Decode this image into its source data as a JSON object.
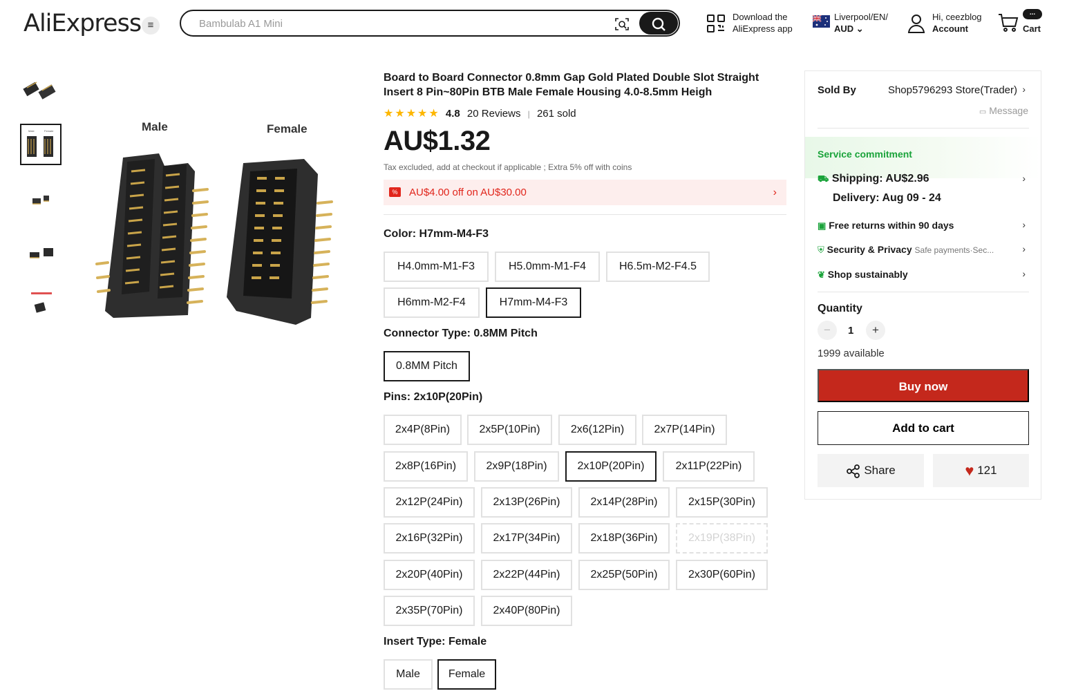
{
  "header": {
    "logo": "AliExpress",
    "search_placeholder": "Bambulab A1 Mini",
    "app_line1": "Download the",
    "app_line2": "AliExpress app",
    "locale_line1": "Liverpool/EN/",
    "locale_line2": "AUD",
    "account_line1": "Hi, ceezblog",
    "account_line2": "Account",
    "cart_label": "Cart",
    "cart_badge": "..."
  },
  "gallery": {
    "label_male": "Male",
    "label_female": "Female"
  },
  "product": {
    "title": "Board to Board Connector 0.8mm Gap Gold Plated Double Slot Straight Insert 8 Pin~80Pin BTB Male Female Housing 4.0-8.5mm Heigh",
    "rating": "4.8",
    "rating_stars": 5,
    "reviews": "20 Reviews",
    "sold": "261 sold",
    "price": "AU$1.32",
    "tax_note": "Tax excluded, add at checkout if applicable ; Extra 5% off with coins",
    "coupon": "AU$4.00 off on AU$30.00",
    "color_label": "Color: H7mm-M4-F3",
    "colors": [
      "H4.0mm-M1-F3",
      "H5.0mm-M1-F4",
      "H6.5m-M2-F4.5",
      "H6mm-M2-F4",
      "H7mm-M4-F3"
    ],
    "connector_label": "Connector Type: 0.8MM Pitch",
    "connectors": [
      "0.8MM Pitch"
    ],
    "pins_label": "Pins: 2x10P(20Pin)",
    "pins": [
      "2x4P(8Pin)",
      "2x5P(10Pin)",
      "2x6(12Pin)",
      "2x7P(14Pin)",
      "2x8P(16Pin)",
      "2x9P(18Pin)",
      "2x10P(20Pin)",
      "2x11P(22Pin)",
      "2x12P(24Pin)",
      "2x13P(26Pin)",
      "2x14P(28Pin)",
      "2x15P(30Pin)",
      "2x16P(32Pin)",
      "2x17P(34Pin)",
      "2x18P(36Pin)",
      "2x19P(38Pin)",
      "2x20P(40Pin)",
      "2x22P(44Pin)",
      "2x25P(50Pin)",
      "2x30P(60Pin)",
      "2x35P(70Pin)",
      "2x40P(80Pin)"
    ],
    "insert_label": "Insert Type: Female",
    "inserts": [
      "Male",
      "Female"
    ]
  },
  "sidebar": {
    "sold_by_label": "Sold By",
    "store": "Shop5796293 Store(Trader)",
    "message": "Message",
    "service_title": "Service commitment",
    "shipping": "Shipping: AU$2.96",
    "delivery": "Delivery: Aug 09 - 24",
    "returns": "Free returns within 90 days",
    "security": "Security & Privacy",
    "security_sub": "Safe payments·Sec...",
    "sustain": "Shop sustainably",
    "quantity_label": "Quantity",
    "quantity": "1",
    "available": "1999 available",
    "buy_now": "Buy now",
    "add_to_cart": "Add to cart",
    "share": "Share",
    "wishlist_count": "121",
    "accent": "#c4281c",
    "green": "#1aa33a"
  }
}
